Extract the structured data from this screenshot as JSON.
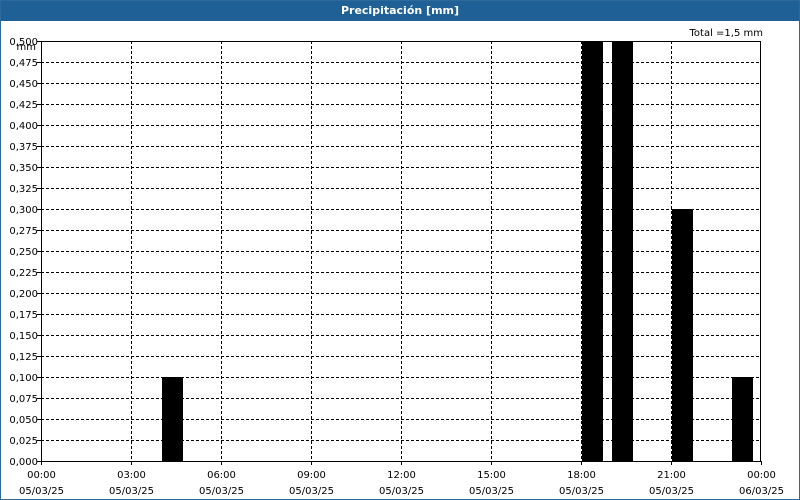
{
  "window": {
    "title": "Precipitación [mm]"
  },
  "total_label": "Total =1,5 mm",
  "colors": {
    "title_bar": "#1f6196",
    "bar": "#000000",
    "grid": "#000000"
  },
  "chart_data": {
    "type": "bar",
    "title": "Precipitación [mm]",
    "ylabel": "mm",
    "xlabel": "",
    "ylim": [
      0,
      0.5
    ],
    "yticks": [
      0,
      0.025,
      0.05,
      0.075,
      0.1,
      0.125,
      0.15,
      0.175,
      0.2,
      0.225,
      0.25,
      0.275,
      0.3,
      0.325,
      0.35,
      0.375,
      0.4,
      0.425,
      0.45,
      0.475,
      0.5
    ],
    "ytick_labels": [
      "0,000",
      "0,025",
      "0,050",
      "0,075",
      "0,100",
      "0,125",
      "0,150",
      "0,175",
      "0,200",
      "0,225",
      "0,250",
      "0,275",
      "0,300",
      "0,325",
      "0,350",
      "0,375",
      "0,400",
      "0,425",
      "0,450",
      "0,475",
      "0,500"
    ],
    "xlim_hours": [
      0,
      24
    ],
    "xticks": [
      {
        "time": "00:00",
        "date": "05/03/25",
        "hour": 0
      },
      {
        "time": "03:00",
        "date": "05/03/25",
        "hour": 3
      },
      {
        "time": "06:00",
        "date": "05/03/25",
        "hour": 6
      },
      {
        "time": "09:00",
        "date": "05/03/25",
        "hour": 9
      },
      {
        "time": "12:00",
        "date": "05/03/25",
        "hour": 12
      },
      {
        "time": "15:00",
        "date": "05/03/25",
        "hour": 15
      },
      {
        "time": "18:00",
        "date": "05/03/25",
        "hour": 18
      },
      {
        "time": "21:00",
        "date": "05/03/25",
        "hour": 21
      },
      {
        "time": "00:00",
        "date": "06/03/25",
        "hour": 24
      }
    ],
    "bars": [
      {
        "hour_start": 4,
        "hour_end": 4.7,
        "value": 0.1
      },
      {
        "hour_start": 18,
        "hour_end": 18.7,
        "value": 0.5
      },
      {
        "hour_start": 19,
        "hour_end": 19.7,
        "value": 0.5
      },
      {
        "hour_start": 21,
        "hour_end": 21.7,
        "value": 0.3
      },
      {
        "hour_start": 23,
        "hour_end": 23.7,
        "value": 0.1
      }
    ],
    "grid": true,
    "total": 1.5
  }
}
